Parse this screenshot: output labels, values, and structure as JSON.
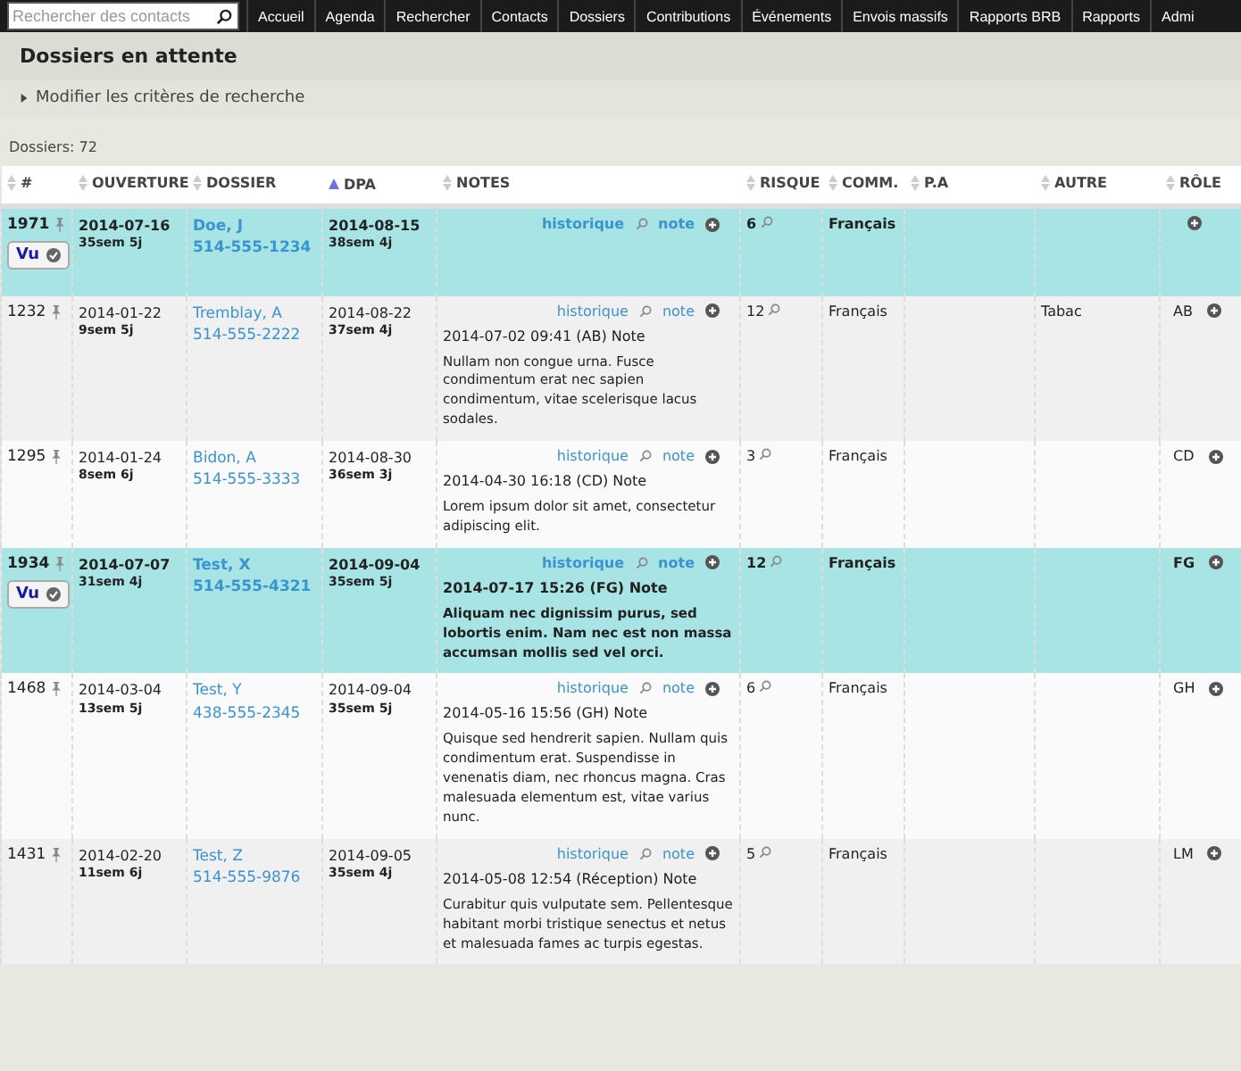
{
  "navbar": {
    "search": {
      "placeholder": "Rechercher des contacts"
    },
    "items": [
      "Accueil",
      "Agenda",
      "Rechercher",
      "Contacts",
      "Dossiers",
      "Contributions",
      "Événements",
      "Envois massifs",
      "Rapports BRB",
      "Rapports",
      "Admi"
    ]
  },
  "page_title": "Dossiers en attente",
  "filter_toggle": {
    "label": "Modifier les critères de recherche",
    "expanded": false
  },
  "count": "Dossiers: 72",
  "table": {
    "columns": [
      {
        "label": "#",
        "sorted": false
      },
      {
        "label": "OUVERTURE",
        "sorted": false
      },
      {
        "label": "DOSSIER",
        "sorted": false
      },
      {
        "label": "DPA",
        "sorted": true
      },
      {
        "label": "NOTES",
        "sorted": false
      },
      {
        "label": "RISQUE",
        "sorted": false
      },
      {
        "label": "COMM.",
        "sorted": false
      },
      {
        "label": "P.A",
        "sorted": false
      },
      {
        "label": "AUTRE",
        "sorted": false
      },
      {
        "label": "RÔLE",
        "sorted": false
      }
    ],
    "rows": [
      {
        "unread": true,
        "id": "1971",
        "seen_button": "Vu",
        "opened": "2014-07-16",
        "opened_age": "35sem 5j",
        "name": "Doe, J",
        "phone": "514-555-1234",
        "dpa": "2014-08-15",
        "dpa_age": "38sem 4j",
        "history": "historique",
        "note_link": "note",
        "risk": "6",
        "comm": "Français"
      },
      {
        "unread": false,
        "id": "1232",
        "opened": "2014-01-22",
        "opened_age": "9sem 5j",
        "name": "Tremblay, A",
        "phone": "514-555-2222",
        "dpa": "2014-08-22",
        "dpa_age": "37sem 4j",
        "history": "historique",
        "note_link": "note",
        "note_title": "2014-07-02 09:41 (AB) Note",
        "note_text": "Nullam non congue urna. Fusce condimentum erat nec sapien condimentum, vitae scelerisque lacus sodales.",
        "risk": "12",
        "comm": "Français",
        "autre": "Tabac",
        "role": "AB"
      },
      {
        "unread": false,
        "id": "1295",
        "opened": "2014-01-24",
        "opened_age": "8sem 6j",
        "name": "Bidon, A",
        "phone": "514-555-3333",
        "dpa": "2014-08-30",
        "dpa_age": "36sem 3j",
        "history": "historique",
        "note_link": "note",
        "note_title": "2014-04-30 16:18 (CD) Note",
        "note_text": "Lorem ipsum dolor sit amet, consectetur adipiscing elit.",
        "risk": "3",
        "comm": "Français",
        "role": "CD"
      },
      {
        "unread": true,
        "id": "1934",
        "seen_button": "Vu",
        "opened": "2014-07-07",
        "opened_age": "31sem 4j",
        "name": "Test, X",
        "phone": "514-555-4321",
        "dpa": "2014-09-04",
        "dpa_age": "35sem 5j",
        "history": "historique",
        "note_link": "note",
        "note_title": "2014-07-17 15:26 (FG) Note",
        "note_text": "Aliquam nec dignissim purus, sed lobortis enim. Nam nec est non massa accumsan mollis sed vel orci.",
        "risk": "12",
        "comm": "Français",
        "role": "FG"
      },
      {
        "unread": false,
        "id": "1468",
        "opened": "2014-03-04",
        "opened_age": "13sem 5j",
        "name": "Test, Y",
        "phone": "438-555-2345",
        "dpa": "2014-09-04",
        "dpa_age": "35sem 5j",
        "history": "historique",
        "note_link": "note",
        "note_title": "2014-05-16 15:56 (GH) Note",
        "note_text": "Quisque sed hendrerit sapien. Nullam quis condimentum erat. Suspendisse in venenatis diam, nec rhoncus magna. Cras malesuada elementum est, vitae varius nunc.",
        "risk": "6",
        "comm": "Français",
        "role": "GH"
      },
      {
        "unread": false,
        "id": "1431",
        "opened": "2014-02-20",
        "opened_age": "11sem 6j",
        "name": "Test, Z",
        "phone": "514-555-9876",
        "dpa": "2014-09-05",
        "dpa_age": "35sem 4j",
        "history": "historique",
        "note_link": "note",
        "note_title": "2014-05-08 12:54 (Réception) Note",
        "note_text": "Curabitur quis vulputate sem. Pellentesque habitant morbi tristique senectus et netus et malesuada fames ac turpis egestas.",
        "risk": "5",
        "comm": "Français",
        "role": "LM"
      }
    ]
  }
}
